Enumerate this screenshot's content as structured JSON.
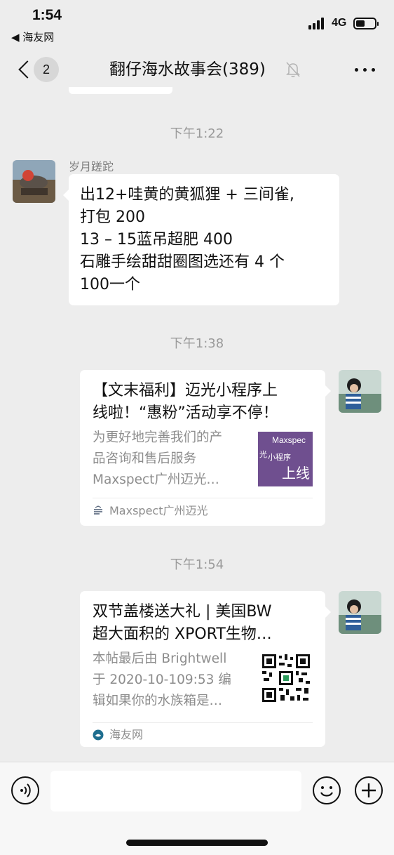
{
  "status_bar": {
    "time": "1:54",
    "back_app": "◀ 海友网",
    "network": "4G"
  },
  "nav": {
    "unread_count": "2",
    "title": "翻仔海水故事会(389)"
  },
  "messages": [
    {
      "type": "timestamp",
      "text": "下午1:22"
    },
    {
      "type": "text",
      "sender": "岁月蹉跎",
      "lines": [
        "出12+哇黄的黄狐狸 + 三间雀,",
        "打包 200",
        "13 – 15蓝吊超肥 400",
        "石雕手绘甜甜圈图选还有 4 个",
        "100一个"
      ]
    },
    {
      "type": "timestamp",
      "text": "下午1:38"
    },
    {
      "type": "link_card",
      "title_lines": [
        "【文末福利】迈光小程序上",
        "线啦！“惠粉”活动享不停！"
      ],
      "desc_lines": [
        "为更好地完善我们的产",
        "品咨询和售后服务",
        "Maxspect广州迈光…"
      ],
      "thumb_text": [
        "Maxspec",
        "光",
        "小程序",
        "上线"
      ],
      "source": "Maxspect广州迈光"
    },
    {
      "type": "timestamp",
      "text": "下午1:54"
    },
    {
      "type": "link_card",
      "title_lines": [
        "双节盖楼送大礼 | 美国BW",
        "超大面积的 XPORT生物…"
      ],
      "desc_lines": [
        "本帖最后由 Brightwell",
        "于 2020-10-109:53 编",
        "辑如果你的水族箱是…"
      ],
      "source": "海友网"
    }
  ],
  "icons": {
    "voice": "voice-input-icon",
    "emoji": "emoji-icon",
    "plus": "plus-icon",
    "mute": "mute-bell-icon",
    "more": "more-dots-icon",
    "back": "chevron-left-icon"
  },
  "colors": {
    "background": "#ededed",
    "bubble": "#ffffff",
    "thumb_purple": "#6f4f8f"
  }
}
